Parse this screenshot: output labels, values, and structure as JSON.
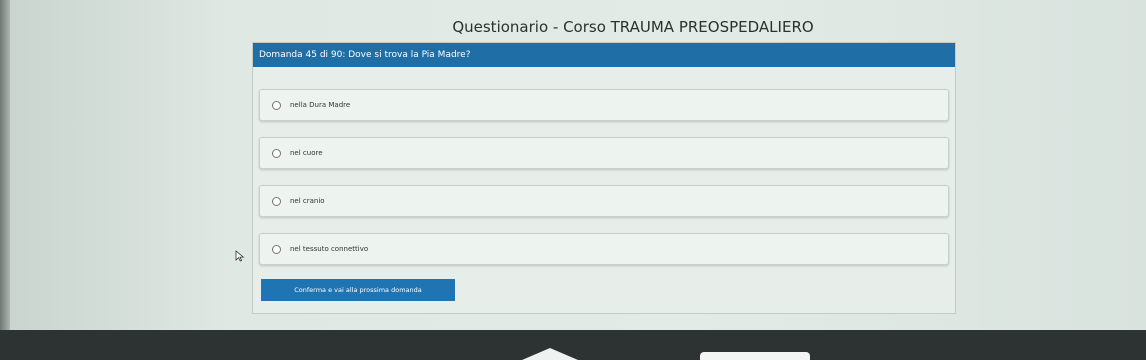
{
  "page": {
    "title": "Questionario - Corso TRAUMA PREOSPEDALIERO"
  },
  "question": {
    "header": "Domanda 45 di 90: Dove si trova la Pia Madre?"
  },
  "options": [
    {
      "label": "nella Dura Madre",
      "selected": false
    },
    {
      "label": "nel cuore",
      "selected": false
    },
    {
      "label": "nel cranio",
      "selected": false
    },
    {
      "label": "nel tessuto connettivo",
      "selected": false
    }
  ],
  "actions": {
    "confirm_label": "Conferma e vai alla prossima domanda"
  },
  "colors": {
    "header_bg": "#1f6ea6",
    "button_bg": "#1f74b3",
    "card_bg": "#e7eeea"
  },
  "icons": {
    "cursor": "mouse-pointer-icon",
    "radio": "radio-button-icon"
  }
}
